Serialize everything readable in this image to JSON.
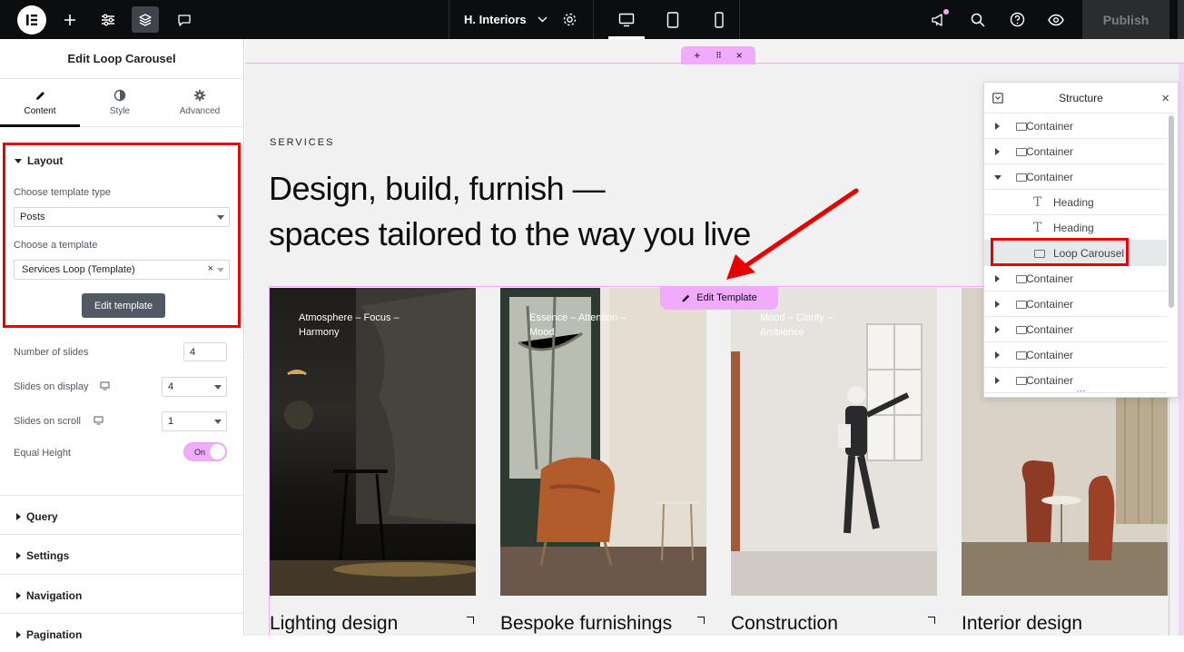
{
  "topbar": {
    "site_name": "H. Interiors",
    "publish_label": "Publish",
    "accent": "#f0abfc"
  },
  "panel": {
    "title": "Edit Loop Carousel",
    "tabs": [
      {
        "label": "Content",
        "icon": "pencil-icon",
        "active": true
      },
      {
        "label": "Style",
        "icon": "half-circle-icon",
        "active": false
      },
      {
        "label": "Advanced",
        "icon": "gear-icon",
        "active": false
      }
    ],
    "layout": {
      "title": "Layout",
      "template_type_label": "Choose template type",
      "template_type_value": "Posts",
      "template_label": "Choose a template",
      "template_value": "Services Loop (Template)",
      "edit_button": "Edit template"
    },
    "controls": {
      "num_slides_label": "Number of slides",
      "num_slides_value": "4",
      "slides_display_label": "Slides on display",
      "slides_display_value": "4",
      "slides_scroll_label": "Slides on scroll",
      "slides_scroll_value": "1",
      "equal_height_label": "Equal Height",
      "equal_height_value": "On"
    },
    "sections": [
      "Query",
      "Settings",
      "Navigation",
      "Pagination"
    ]
  },
  "canvas": {
    "eyebrow": "SERVICES",
    "heading_line1": "Design, build, furnish —",
    "heading_line2": "spaces tailored to the way you live",
    "edit_template_label": "Edit Template",
    "cards": [
      {
        "caption": "Atmosphere – Focus – Harmony",
        "title": "Lighting design"
      },
      {
        "caption": "Essence – Attention – Mood",
        "title": "Bespoke furnishings"
      },
      {
        "caption": "Mood – Clarity – Ambience",
        "title": "Construction"
      },
      {
        "caption": "",
        "title": "Interior design"
      }
    ]
  },
  "structure": {
    "title": "Structure",
    "rows": [
      {
        "label": "Container",
        "indent": false,
        "kind": "container",
        "caret": "closed"
      },
      {
        "label": "Container",
        "indent": false,
        "kind": "container",
        "caret": "closed"
      },
      {
        "label": "Container",
        "indent": false,
        "kind": "container",
        "caret": "open"
      },
      {
        "label": "Heading",
        "indent": true,
        "kind": "heading",
        "caret": "none"
      },
      {
        "label": "Heading",
        "indent": true,
        "kind": "heading",
        "caret": "none"
      },
      {
        "label": "Loop Carousel",
        "indent": true,
        "kind": "loop",
        "caret": "none",
        "selected": true
      },
      {
        "label": "Container",
        "indent": false,
        "kind": "container",
        "caret": "closed"
      },
      {
        "label": "Container",
        "indent": false,
        "kind": "container",
        "caret": "closed"
      },
      {
        "label": "Container",
        "indent": false,
        "kind": "container",
        "caret": "closed"
      },
      {
        "label": "Container",
        "indent": false,
        "kind": "container",
        "caret": "closed"
      },
      {
        "label": "Container",
        "indent": false,
        "kind": "container",
        "caret": "closed"
      }
    ]
  }
}
